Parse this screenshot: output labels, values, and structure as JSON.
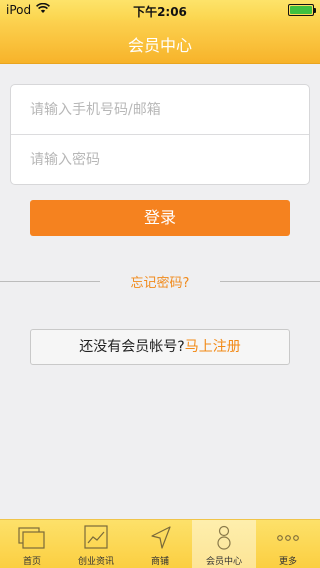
{
  "status_bar": {
    "carrier": "iPod",
    "time": "下午2:06",
    "wifi_icon": "wifi-icon",
    "battery_icon": "battery-icon",
    "battery_color": "#3fc13f"
  },
  "nav": {
    "title": "会员中心"
  },
  "form": {
    "phone_placeholder": "请输入手机号码/邮箱",
    "phone_value": "",
    "password_placeholder": "请输入密码",
    "password_value": ""
  },
  "login_button": "登录",
  "forgot_password": "忘记密码?",
  "register": {
    "prompt": "还没有会员帐号?",
    "link": "马上注册"
  },
  "tabs": [
    {
      "label": "首页",
      "icon": "home-icon"
    },
    {
      "label": "创业资讯",
      "icon": "news-icon"
    },
    {
      "label": "商铺",
      "icon": "location-arrow-icon"
    },
    {
      "label": "会员中心",
      "icon": "user-icon",
      "active": true
    },
    {
      "label": "更多",
      "icon": "more-icon"
    }
  ],
  "colors": {
    "accent": "#f5821f",
    "link": "#f08a1c",
    "bar_yellow": "#fbd54e"
  }
}
